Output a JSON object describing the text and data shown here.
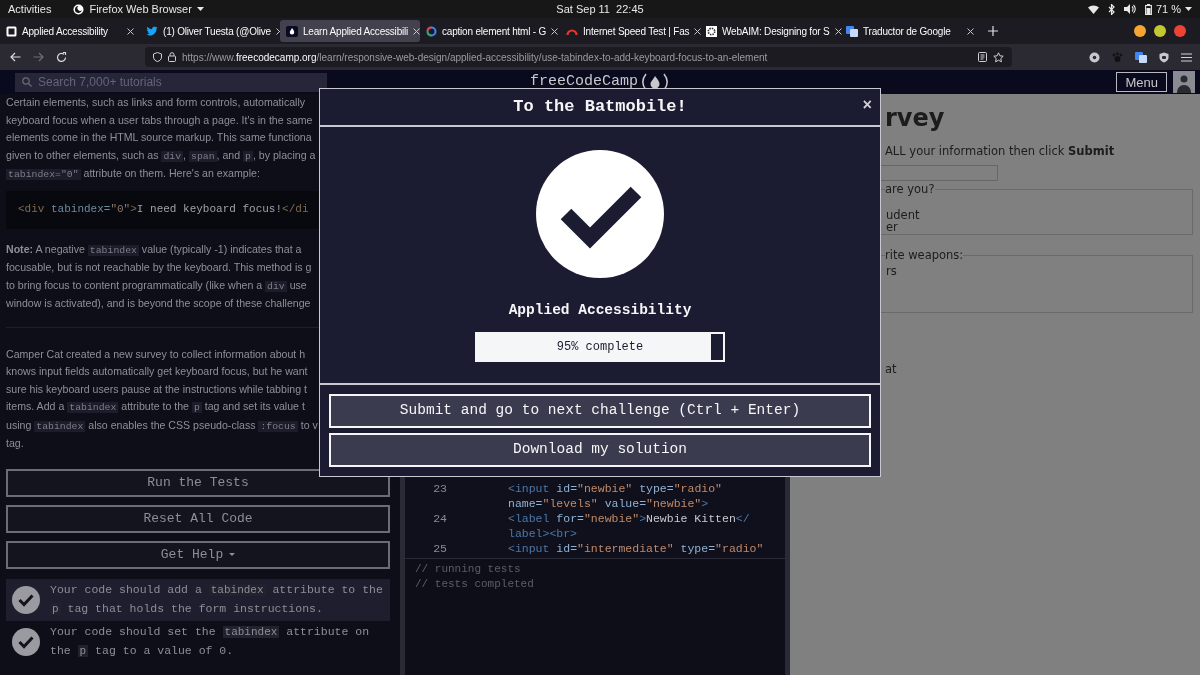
{
  "system_bar": {
    "activities": "Activities",
    "app": "Firefox Web Browser",
    "clock": "Sat Sep 11  22:45",
    "battery": "71 %"
  },
  "tabs": [
    {
      "title": "Applied Accessibility",
      "kind": "notion",
      "selected": false
    },
    {
      "title": "(1) Oliver Tuesta (@Olive",
      "kind": "bird",
      "selected": false
    },
    {
      "title": "Learn Applied Accessibili",
      "kind": "fcc",
      "selected": true
    },
    {
      "title": "caption element html - G",
      "kind": "google",
      "selected": false
    },
    {
      "title": "Internet Speed Test | Fas",
      "kind": "gauge",
      "selected": false
    },
    {
      "title": "WebAIM: Designing for S",
      "kind": "gear",
      "selected": false
    },
    {
      "title": "Traductor de Google",
      "kind": "translate",
      "selected": false
    }
  ],
  "address_bar": {
    "prefix": "https://www.",
    "domain": "freecodecamp.org",
    "path": "/learn/responsive-web-design/applied-accessibility/use-tabindex-to-add-keyboard-focus-to-an-element"
  },
  "site_nav": {
    "search_placeholder": "Search 7,000+ tutorials",
    "logo": "freeCodeCamp",
    "menu": "Menu"
  },
  "lesson": {
    "intro": [
      [
        "Certain elements, such as links and form controls, automatically"
      ],
      [
        "keyboard focus when a user tabs through a page. It's in the same"
      ],
      [
        "elements come in the HTML source markup. This same functiona"
      ],
      [
        "given to other elements, such as ",
        {
          "code": "div"
        },
        ", ",
        {
          "code": "span"
        },
        ", and ",
        {
          "code": "p"
        },
        ", by placing a"
      ],
      [
        {
          "code": "tabindex=\"0\""
        },
        " attribute on them. Here's an example:"
      ]
    ],
    "example": [
      {
        "kind": "tag",
        "text": "<div"
      },
      {
        "kind": "attr",
        "text": " tabindex="
      },
      {
        "kind": "str",
        "text": "\"0\""
      },
      {
        "kind": "tag",
        "text": ">"
      },
      {
        "kind": "text",
        "text": "I need keyboard focus!"
      },
      {
        "kind": "tag",
        "text": "</di"
      }
    ],
    "note": [
      [
        "**Note:** A negative ",
        {
          "code": "tabindex"
        },
        " value (typically -1) indicates that a"
      ],
      [
        "focusable, but is not reachable by the keyboard. This method is g"
      ],
      [
        "to bring focus to content programmatically (like when a ",
        {
          "code": "div"
        },
        " use"
      ],
      [
        "window is activated), and is beyond the scope of these challenge"
      ]
    ],
    "task": [
      [
        "Camper Cat created a new survey to collect information about h"
      ],
      [
        "knows input fields automatically get keyboard focus, but he want"
      ],
      [
        "sure his keyboard users pause at the instructions while tabbing t"
      ],
      [
        "items. Add a ",
        {
          "code": "tabindex"
        },
        " attribute to the ",
        {
          "code": "p"
        },
        " tag and set its value t"
      ],
      [
        "using ",
        {
          "code": "tabindex"
        },
        " also enables the CSS pseudo-class ",
        {
          "code": ":focus"
        },
        " to v"
      ],
      [
        "tag."
      ]
    ]
  },
  "buttons": [
    {
      "label": "Run the Tests",
      "dropdown": false
    },
    {
      "label": "Reset All Code",
      "dropdown": false
    },
    {
      "label": "Get Help",
      "dropdown": true
    }
  ],
  "tests": [
    {
      "passed": true,
      "highlighted": true,
      "lines": [
        [
          "Your code should add a ",
          {
            "code": "tabindex"
          },
          " attribute to the"
        ],
        [
          {
            "code": "p"
          },
          " tag that holds the form instructions."
        ]
      ]
    },
    {
      "passed": true,
      "highlighted": false,
      "lines": [
        [
          "Your code should set the ",
          {
            "code": "tabindex"
          },
          " attribute on"
        ],
        [
          "the ",
          {
            "code": "p"
          },
          " tag to a value of 0."
        ]
      ]
    }
  ],
  "editor": {
    "lines": [
      {
        "number": "23",
        "tokens": [
          {
            "kind": "tag",
            "text": "<input"
          },
          {
            "kind": "attr",
            "text": " id="
          },
          {
            "kind": "str",
            "text": "\"newbie\""
          },
          {
            "kind": "attr",
            "text": " type="
          },
          {
            "kind": "str",
            "text": "\"radio\""
          }
        ]
      },
      {
        "tokens": [
          {
            "kind": "attr",
            "text": "name="
          },
          {
            "kind": "str",
            "text": "\"levels\""
          },
          {
            "kind": "attr",
            "text": " value="
          },
          {
            "kind": "str",
            "text": "\"newbie\""
          },
          {
            "kind": "tag",
            "text": ">"
          }
        ]
      },
      {
        "number": "24",
        "tokens": [
          {
            "kind": "tag",
            "text": "<label"
          },
          {
            "kind": "attr",
            "text": " for="
          },
          {
            "kind": "str",
            "text": "\"newbie\""
          },
          {
            "kind": "tag",
            "text": ">"
          },
          {
            "kind": "text",
            "text": "Newbie Kitten"
          },
          {
            "kind": "tag",
            "text": "</"
          }
        ]
      },
      {
        "tokens": [
          {
            "kind": "tag",
            "text": "label><br>"
          }
        ]
      },
      {
        "number": "25",
        "tokens": [
          {
            "kind": "tag",
            "text": "<input"
          },
          {
            "kind": "attr",
            "text": " id="
          },
          {
            "kind": "str",
            "text": "\"intermediate\""
          },
          {
            "kind": "attr",
            "text": " type="
          },
          {
            "kind": "str",
            "text": "\"radio\""
          }
        ]
      }
    ],
    "console": [
      "// running tests",
      "// tests completed"
    ]
  },
  "preview": {
    "heading": "rvey",
    "instructions": "ALL your information then click **Submit**",
    "fieldsets": [
      {
        "legend": "are you?",
        "lines": [
          "udent",
          "er"
        ]
      },
      {
        "legend": "rite weapons:",
        "lines": [
          "rs"
        ]
      }
    ],
    "footer": "at"
  },
  "modal": {
    "title": "To the Batmobile!",
    "close": "×",
    "block": "Applied Accessibility",
    "progress": {
      "level": 0.95,
      "label": "95% complete"
    },
    "buttons": [
      "Submit and go to next challenge (Ctrl + Enter)",
      "Download my solution"
    ]
  }
}
